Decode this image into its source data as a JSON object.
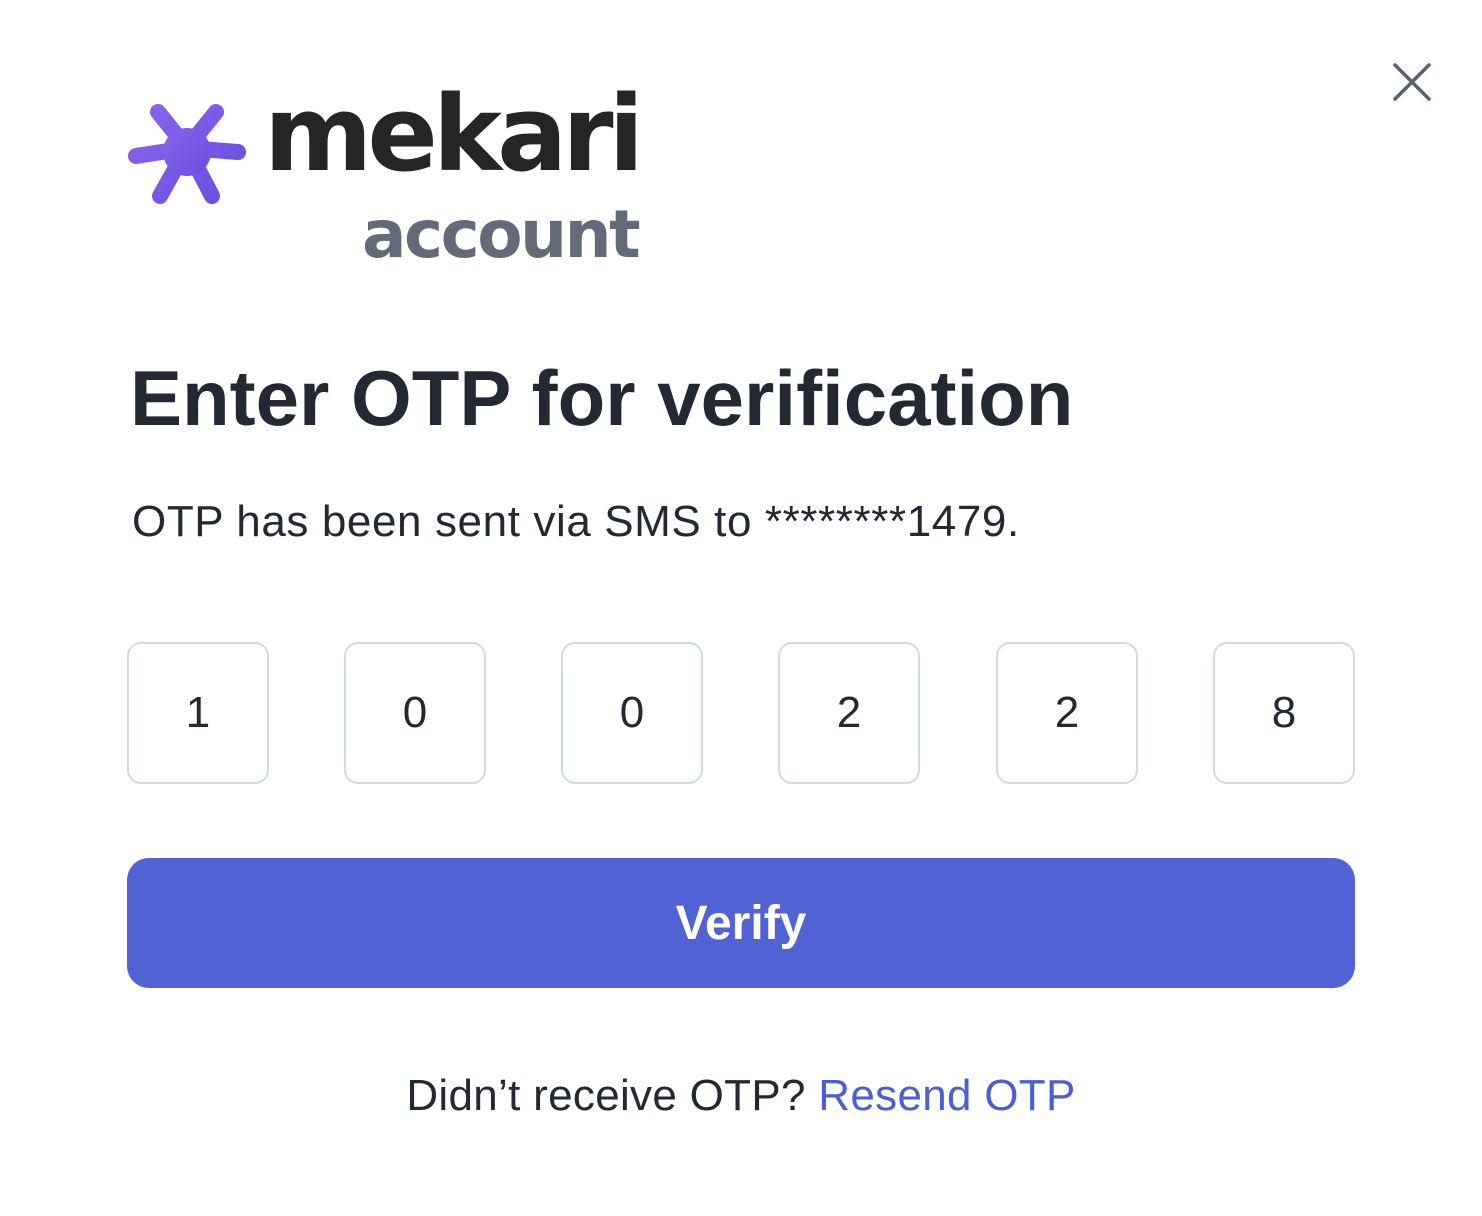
{
  "logo": {
    "brand": "mekari",
    "sub": "account",
    "star_color": "#7a5ce6"
  },
  "close_icon": "close-icon",
  "title": "Enter OTP for verification",
  "subtitle": "OTP has been sent via SMS to ********1479.",
  "otp": {
    "digits": [
      "1",
      "0",
      "0",
      "2",
      "2",
      "8"
    ]
  },
  "verify_label": "Verify",
  "resend": {
    "prompt": "Didn’t receive OTP?",
    "link": "Resend OTP"
  },
  "colors": {
    "primary": "#5062d4",
    "link": "#4a5fd1",
    "text": "#232933",
    "border": "#d3d9e1"
  }
}
